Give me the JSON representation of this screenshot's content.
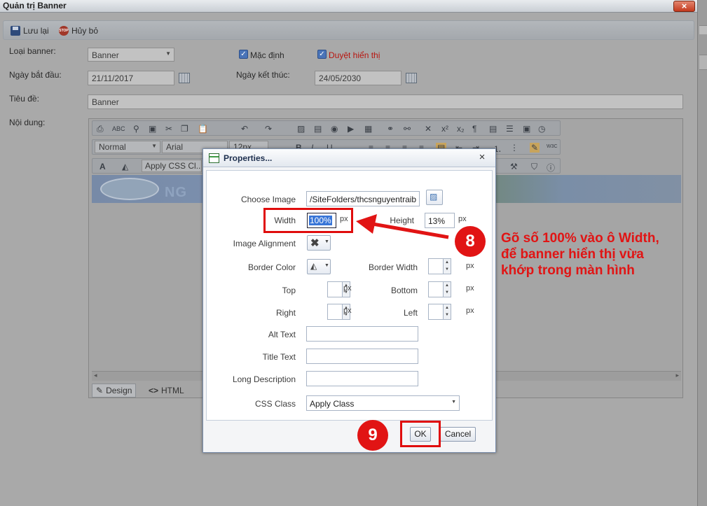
{
  "window": {
    "title": "Quản trị Banner",
    "close": "×"
  },
  "toolbar": {
    "save": "Lưu lại",
    "cancel": "Hủy bỏ",
    "stop_glyph": "STOP"
  },
  "form": {
    "banner_type_label": "Loại banner:",
    "banner_type_value": "Banner",
    "default_label": "Mặc định",
    "approved_label": "Duyệt hiển thị",
    "start_date_label": "Ngày bắt đầu:",
    "start_date_value": "21/11/2017",
    "end_date_label": "Ngày kết thúc:",
    "end_date_value": "24/05/2030",
    "title_label": "Tiêu đề:",
    "title_value": "Banner",
    "content_label": "Nội dung:"
  },
  "editor": {
    "format_value": "Normal",
    "font_value": "Arial",
    "size_value": "12px",
    "css_class_value": "Apply CSS Cl...",
    "banner_text": "NG",
    "design_tab": "Design",
    "html_tab": "HTML"
  },
  "dialog": {
    "title": "Properties...",
    "close": "×",
    "choose_image_label": "Choose Image",
    "choose_image_value": "/SiteFolders/thcsnguyentraib",
    "width_label": "Width",
    "width_value": "100%",
    "height_label": "Height",
    "height_value": "13%",
    "unit": "px",
    "alignment_label": "Image Alignment",
    "border_color_label": "Border Color",
    "border_width_label": "Border Width",
    "top_label": "Top",
    "bottom_label": "Bottom",
    "right_label": "Right",
    "left_label": "Left",
    "alt_text_label": "Alt Text",
    "title_text_label": "Title Text",
    "long_desc_label": "Long Description",
    "css_class_label": "CSS Class",
    "css_class_value": "Apply Class",
    "ok": "OK",
    "cancel": "Cancel"
  },
  "annotations": {
    "step8": "8",
    "step9": "9",
    "instruction": "Gõ số 100% vào ô Width,\nđể banner hiển thị vừa\nkhớp trong màn hình"
  },
  "colors": {
    "accent_red": "#e11414",
    "dialog_border": "#7b8fad"
  }
}
